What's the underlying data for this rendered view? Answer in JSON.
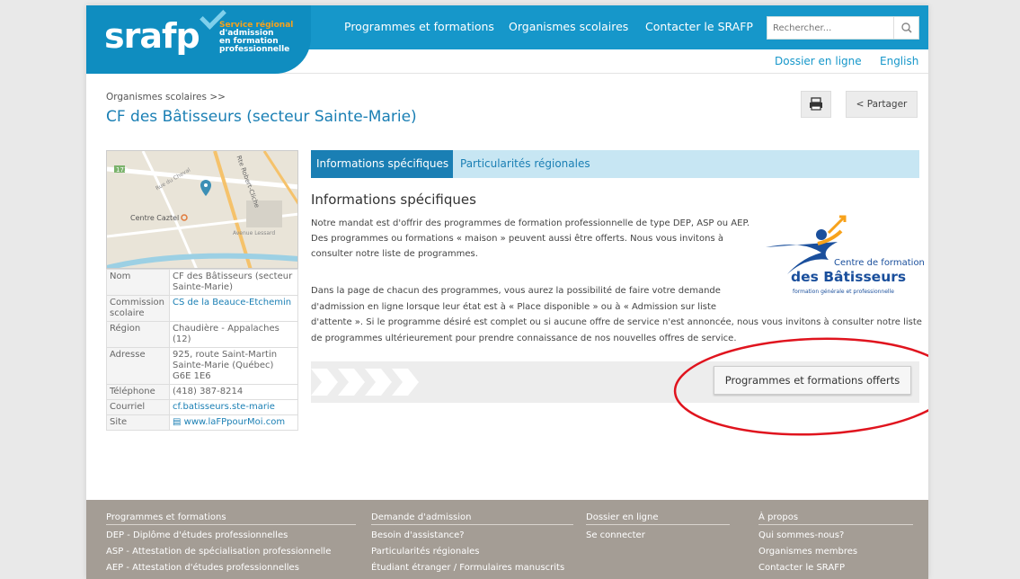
{
  "header": {
    "logo_text": "srafp",
    "logo_tagline": [
      "Service régional",
      "d'admission",
      "en formation",
      "professionnelle"
    ],
    "nav": [
      "Programmes et formations",
      "Organismes scolaires",
      "Contacter le SRAFP"
    ],
    "search_placeholder": "Rechercher...",
    "sublinks": [
      "Dossier en ligne",
      "English"
    ]
  },
  "breadcrumb": "Organismes scolaires  >>",
  "title": "CF des Bâtisseurs (secteur Sainte-Marie)",
  "actions": {
    "share_label": "Partager"
  },
  "map": {
    "place_label": "Centre Caztel",
    "road_label": "Rte Robert-Cliche",
    "route_label": "173",
    "small_labels": [
      "Rue du Cheval",
      "Avenue Lessard"
    ]
  },
  "info": {
    "rows": [
      {
        "key": "Nom",
        "value": "CF des Bâtisseurs (secteur Sainte-Marie)"
      },
      {
        "key": "Commission scolaire",
        "value": "CS de la Beauce-Etchemin"
      },
      {
        "key": "Région",
        "value": "Chaudière - Appalaches (12)"
      },
      {
        "key": "Adresse",
        "value": "925, route Saint-Martin Sainte-Marie (Québec) G6E 1E6"
      },
      {
        "key": "Téléphone",
        "value": "(418) 387-8214"
      },
      {
        "key": "Courriel",
        "value": "cf.batisseurs.ste-marie"
      },
      {
        "key": "Site",
        "value": "www.laFPpourMoi.com"
      }
    ]
  },
  "tabs": [
    "Informations spécifiques",
    "Particularités régionales"
  ],
  "section": {
    "title": "Informations spécifiques",
    "para1": "Notre mandat est d'offrir des programmes de formation professionnelle de type DEP, ASP ou AEP. Des programmes ou formations « maison » peuvent aussi être offerts. Nous vous invitons à consulter notre liste de programmes.",
    "para2a": "Dans la page de chacun des programmes, vous aurez la possibilité de faire votre demande d'admission en ligne lorsque leur état est à « Place disponible » ou à « Admission sur liste",
    "para2b": "d'attente ». Si le programme désiré est complet ou si aucune offre de service n'est annoncée, nous vous invitons à consulter notre liste de programmes ultérieurement pour prendre connaissance de nos nouvelles offres de service."
  },
  "cf_logo": {
    "line1": "Centre de formation",
    "line2": "des Bâtisseurs",
    "line3": "formation générale et professionnelle"
  },
  "cta": "Programmes et formations offerts",
  "colors": {
    "brand_blue": "#1697ca",
    "link_blue": "#1a7fb4",
    "accent_orange": "#f7a21b",
    "annotation_red": "#e0141e",
    "footer_bg": "#a49d95"
  },
  "footer": {
    "columns": [
      {
        "head": "Programmes et formations",
        "links": [
          "DEP - Diplôme d'études professionnelles",
          "ASP - Attestation de spécialisation professionnelle",
          "AEP - Attestation d'études professionnelles"
        ]
      },
      {
        "head": "Demande d'admission",
        "links": [
          "Besoin d'assistance?",
          "Particularités régionales",
          "Étudiant étranger / Formulaires manuscrits"
        ]
      },
      {
        "head": "Dossier en ligne",
        "links": [
          "Se connecter"
        ]
      },
      {
        "head": "À propos",
        "links": [
          "Qui sommes-nous?",
          "Organismes membres",
          "Contacter le SRAFP"
        ]
      }
    ]
  }
}
